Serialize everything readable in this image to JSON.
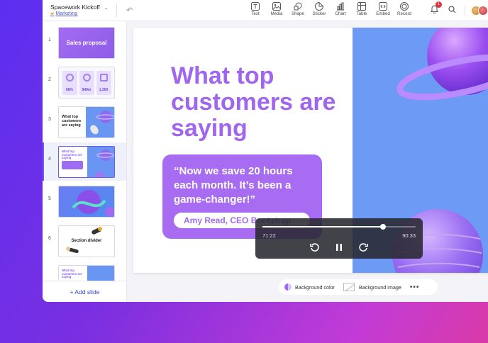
{
  "document": {
    "title": "Spacework Kickoff",
    "folder": "Marketing"
  },
  "toolbar": {
    "tools": [
      {
        "label": "Text",
        "icon": "text-icon"
      },
      {
        "label": "Media",
        "icon": "media-icon"
      },
      {
        "label": "Shape",
        "icon": "shape-icon"
      },
      {
        "label": "Sticker",
        "icon": "sticker-icon"
      },
      {
        "label": "Chart",
        "icon": "chart-icon"
      },
      {
        "label": "Table",
        "icon": "table-icon"
      },
      {
        "label": "Embed",
        "icon": "embed-icon"
      },
      {
        "label": "Record",
        "icon": "record-icon"
      }
    ],
    "notification_count": "1"
  },
  "sidebar": {
    "slides": [
      {
        "number": "1",
        "text": "Sales proposal"
      },
      {
        "number": "2",
        "stats": [
          "68%",
          "$40m",
          "1,260"
        ]
      },
      {
        "number": "3",
        "text": "What top customers are saying"
      },
      {
        "number": "4",
        "text": "What top customers are saying"
      },
      {
        "number": "5"
      },
      {
        "number": "6",
        "text": "Section divider"
      }
    ],
    "add_slide_label": "+ Add slide"
  },
  "slide": {
    "heading": "What top customers are saying",
    "quote": "“Now we save 20 hours each month. It’s been a game-changer!”",
    "author": "Amy Read, CEO Bootstrap"
  },
  "player": {
    "current_time": "71:22",
    "total_time": "90:33",
    "progress": 0.788
  },
  "bottom_bar": {
    "background_color_label": "Background color",
    "background_image_label": "Background image",
    "more_label": "•••"
  },
  "colors": {
    "accent": "#a066ef",
    "slide_blue": "#6d9af4",
    "link": "#3b47c8"
  }
}
